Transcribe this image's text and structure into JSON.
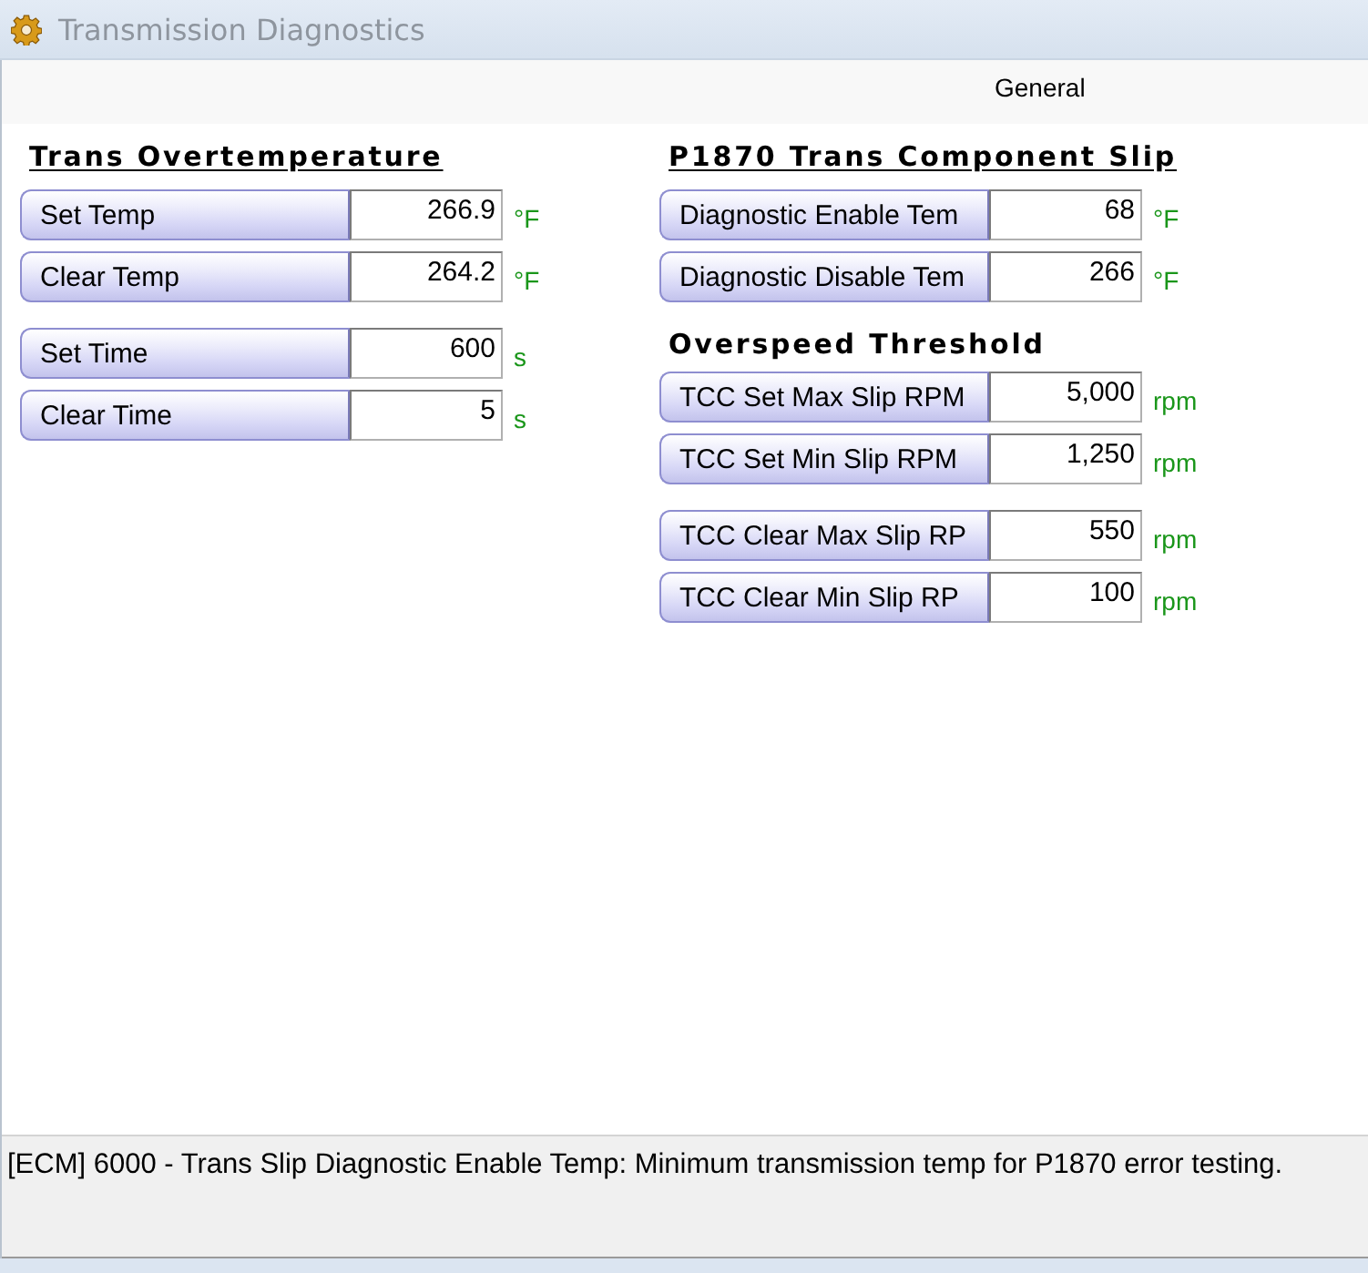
{
  "window": {
    "title": "Transmission Diagnostics"
  },
  "tab": {
    "label": "General"
  },
  "columns": [
    {
      "items": [
        {
          "kind": "title",
          "text": "Trans Overtemperature"
        },
        {
          "kind": "rows",
          "rows": [
            {
              "label": "Set Temp",
              "value": "266.9",
              "unit": "°F"
            },
            {
              "label": "Clear Temp",
              "value": "264.2",
              "unit": "°F"
            }
          ]
        },
        {
          "kind": "rows",
          "rows": [
            {
              "label": "Set Time",
              "value": "600",
              "unit": "s"
            },
            {
              "label": "Clear Time",
              "value": "5",
              "unit": "s"
            }
          ]
        }
      ]
    },
    {
      "items": [
        {
          "kind": "title",
          "text": "P1870 Trans Component Slip"
        },
        {
          "kind": "rows",
          "rows": [
            {
              "label": "Diagnostic Enable Tem",
              "value": "68",
              "unit": "°F"
            },
            {
              "label": "Diagnostic Disable Tem",
              "value": "266",
              "unit": "°F"
            }
          ]
        },
        {
          "kind": "subtitle",
          "text": "Overspeed Threshold"
        },
        {
          "kind": "rows",
          "rows": [
            {
              "label": "TCC Set Max Slip RPM",
              "value": "5,000",
              "unit": "rpm"
            },
            {
              "label": "TCC Set Min Slip RPM",
              "value": "1,250",
              "unit": "rpm"
            }
          ]
        },
        {
          "kind": "rows",
          "rows": [
            {
              "label": "TCC Clear Max Slip RP",
              "value": "550",
              "unit": "rpm"
            },
            {
              "label": "TCC Clear Min Slip RP",
              "value": "100",
              "unit": "rpm"
            }
          ]
        }
      ]
    }
  ],
  "status_bar": {
    "text": "[ECM] 6000 - Trans Slip Diagnostic Enable Temp: Minimum transmission temp for P1870 error testing."
  }
}
